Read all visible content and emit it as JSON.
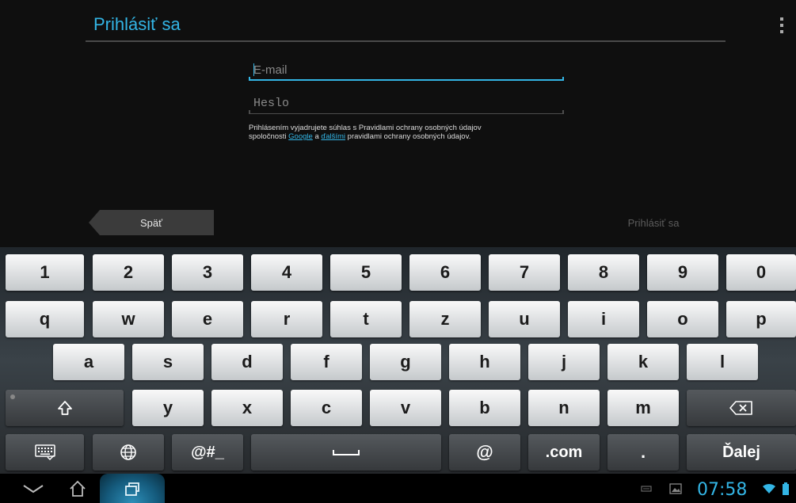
{
  "app": {
    "title": "Prihlásiť sa",
    "menu_icon": "overflow-menu-icon"
  },
  "form": {
    "email_placeholder": "E-mail",
    "password_placeholder": "Heslo",
    "notice_line1": "Prihlásením vyjadrujete súhlas s Pravidlami ochrany osobných údajov",
    "notice_line2_prefix": "spoločnosti ",
    "notice_link_google": "Google",
    "notice_and": " a ",
    "notice_link_others": "ďalšími",
    "notice_line2_suffix": " pravidlami ochrany osobných údajov."
  },
  "buttons": {
    "back": "Späť",
    "sign_in": "Prihlásiť sa"
  },
  "keyboard": {
    "row1": [
      "1",
      "2",
      "3",
      "4",
      "5",
      "6",
      "7",
      "8",
      "9",
      "0"
    ],
    "row2": [
      "q",
      "w",
      "e",
      "r",
      "t",
      "z",
      "u",
      "i",
      "o",
      "p"
    ],
    "row3": [
      "a",
      "s",
      "d",
      "f",
      "g",
      "h",
      "j",
      "k",
      "l"
    ],
    "row4": [
      "y",
      "x",
      "c",
      "v",
      "b",
      "n",
      "m"
    ],
    "symbols": "@#_",
    "at": "@",
    "dotcom": ".com",
    "dot": ".",
    "next": "Ďalej",
    "icons": {
      "shift": "shift-icon",
      "backspace": "backspace-icon",
      "settings": "keyboard-settings-icon",
      "language": "globe-icon",
      "space": "space-icon"
    }
  },
  "statusbar": {
    "time": "07:58",
    "icons": [
      "back-icon",
      "home-icon",
      "recent-apps-icon",
      "keyboard-indicator-icon",
      "image-notification-icon",
      "wifi-icon",
      "battery-icon"
    ]
  },
  "colors": {
    "accent": "#33b5e5",
    "background": "#0f0f0f",
    "key_light": "#e6e8ea",
    "key_dark": "#44484c"
  }
}
